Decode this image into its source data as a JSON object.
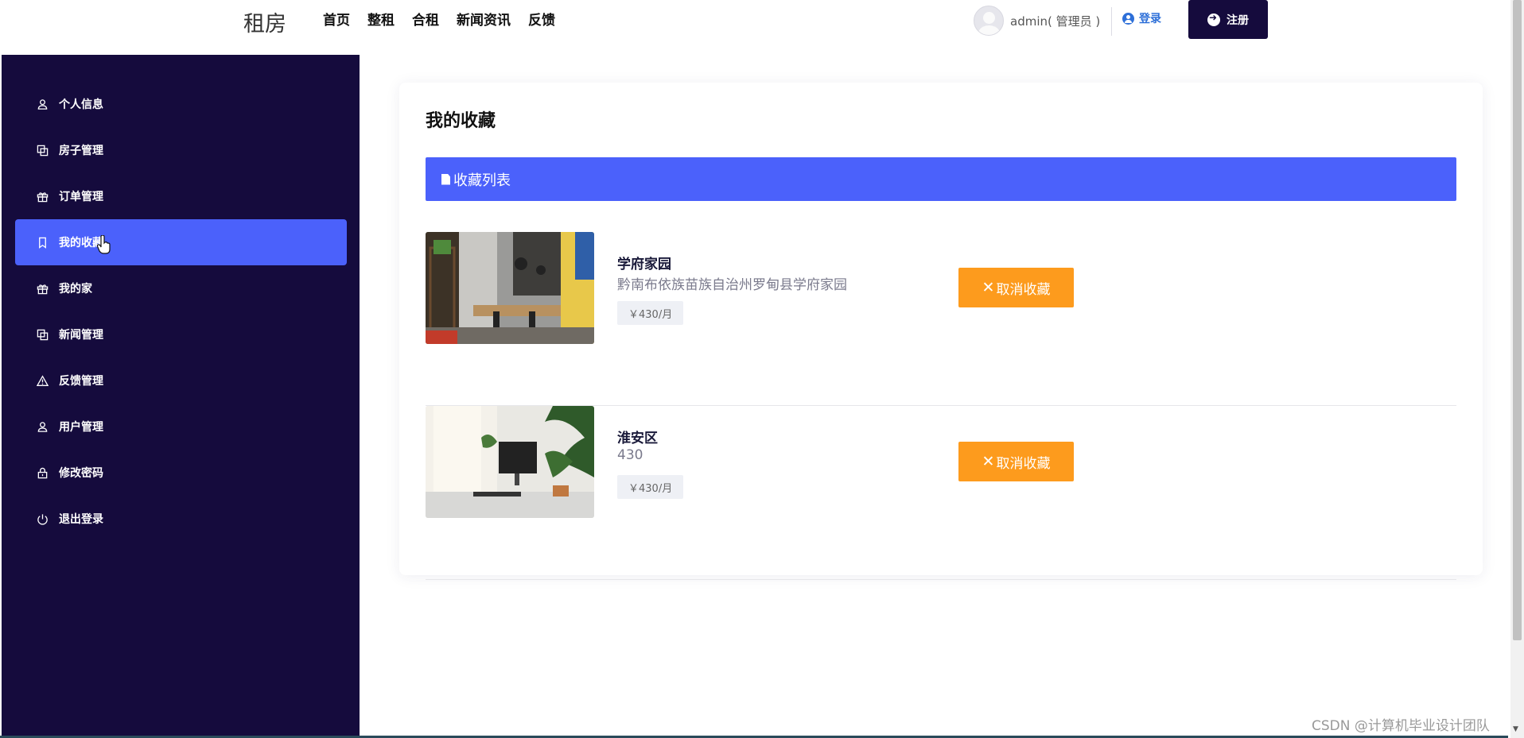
{
  "header": {
    "logo": "租房",
    "nav": [
      "首页",
      "整租",
      "合租",
      "新闻资讯",
      "反馈"
    ],
    "user": "admin( 管理员 )",
    "login_label": "登录",
    "register_label": "注册"
  },
  "sidebar": {
    "items": [
      {
        "label": "个人信息",
        "icon": "user-icon"
      },
      {
        "label": "房子管理",
        "icon": "copy-icon"
      },
      {
        "label": "订单管理",
        "icon": "gift-icon"
      },
      {
        "label": "我的收藏",
        "icon": "bookmark-icon",
        "active": true
      },
      {
        "label": "我的家",
        "icon": "gift-icon"
      },
      {
        "label": "新闻管理",
        "icon": "copy-icon"
      },
      {
        "label": "反馈管理",
        "icon": "warning-icon"
      },
      {
        "label": "用户管理",
        "icon": "user-icon"
      },
      {
        "label": "修改密码",
        "icon": "lock-icon"
      },
      {
        "label": "退出登录",
        "icon": "power-icon"
      }
    ]
  },
  "main": {
    "title": "我的收藏",
    "list_header": "收藏列表",
    "favorites": [
      {
        "title": "学府家园",
        "subtitle": "黔南布依族苗族自治州罗甸县学府家园",
        "price": "￥430/月",
        "action": "取消收藏"
      },
      {
        "title": "淮安区",
        "subtitle": "430",
        "price": "￥430/月",
        "action": "取消收藏"
      }
    ]
  },
  "watermark": "CSDN @计算机毕业设计团队",
  "colors": {
    "sidebar": "#150b3d",
    "accent": "#4b61fb",
    "cancel": "#fd9b1d"
  }
}
